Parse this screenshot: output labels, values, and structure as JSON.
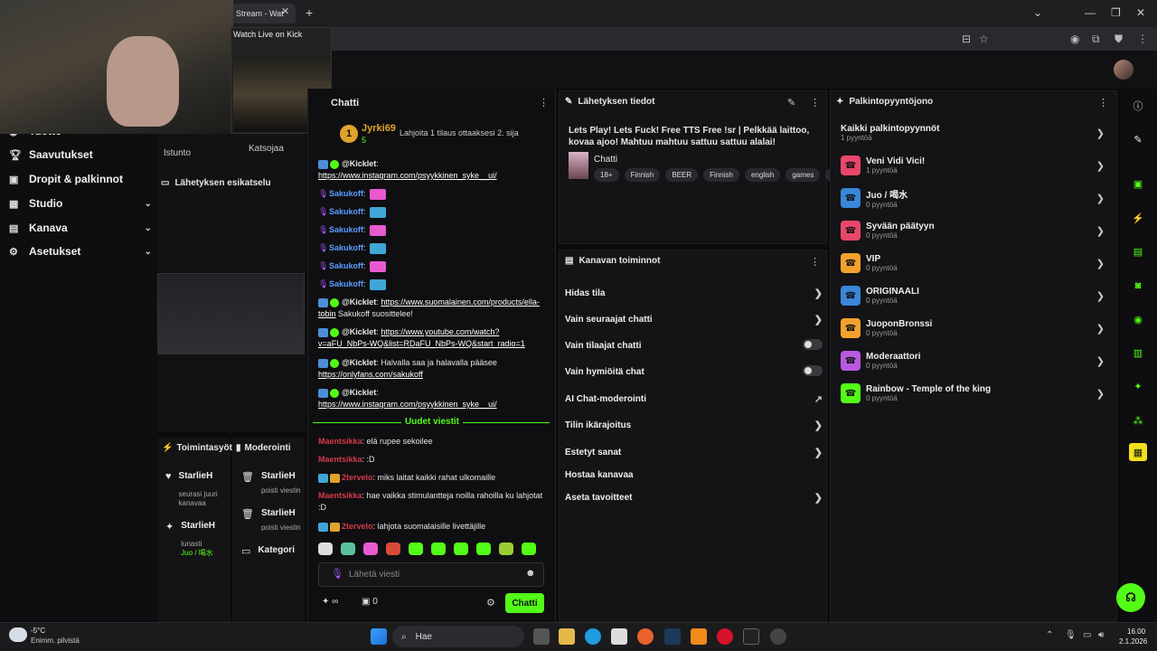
{
  "browser": {
    "tab_title": "Stream - Wat",
    "tab_close": "✕",
    "new_tab": "+",
    "pip_title": "Watch Live on Kick"
  },
  "nav": {
    "items": [
      {
        "label": "Tuotto",
        "icon": "coin-icon"
      },
      {
        "label": "Saavutukset",
        "icon": "trophy-icon"
      },
      {
        "label": "Dropit & palkinnot",
        "icon": "gift-icon"
      },
      {
        "label": "Studio",
        "icon": "studio-icon",
        "chevron": "⌄"
      },
      {
        "label": "Kanava",
        "icon": "channel-icon",
        "chevron": "⌄"
      },
      {
        "label": "Asetukset",
        "icon": "gear-icon",
        "chevron": "⌄"
      }
    ]
  },
  "preview": {
    "tab_istunto": "Istunto",
    "tab_katsojaa": "Katsojaa",
    "title": "Lähetyksen esikatselu"
  },
  "activity": {
    "title": "Toimintasyöte",
    "items": [
      {
        "name": "StarlieH",
        "sub": "seurasi juuri kanavaa"
      },
      {
        "name": "StarlieH",
        "sub": "lunasti",
        "sub2": "Juo / 喝水"
      }
    ]
  },
  "moderation": {
    "title": "Moderointi",
    "items": [
      {
        "name": "StarlieH",
        "sub": "poisti viestin"
      },
      {
        "name": "StarlieH",
        "sub": "poisti viestin"
      },
      {
        "name": "Kategori",
        "sub": ""
      }
    ]
  },
  "chat": {
    "title": "Chatti",
    "gifter": {
      "badge": "1",
      "name": "Jyrki69",
      "count": "5",
      "note": "Lahjoita 1 tilaus ottaaksesi 2. sija"
    },
    "messages": [
      {
        "user": "@Kicklet",
        "text": "https://www.instagram.com/psyykkinen_syke__ui/",
        "type": "bot"
      },
      {
        "user": "Sakukoff",
        "text": "",
        "type": "emote",
        "emote_color": "#e85ad0"
      },
      {
        "user": "Sakukoff",
        "text": "",
        "type": "emote",
        "emote_color": "#3fa7d6"
      },
      {
        "user": "Sakukoff",
        "text": "",
        "type": "emote",
        "emote_color": "#e85ad0"
      },
      {
        "user": "Sakukoff",
        "text": "",
        "type": "emote",
        "emote_color": "#3fa7d6"
      },
      {
        "user": "Sakukoff",
        "text": "",
        "type": "emote",
        "emote_color": "#e85ad0"
      },
      {
        "user": "Sakukoff",
        "text": "",
        "type": "emote",
        "emote_color": "#3fa7d6"
      },
      {
        "user": "@Kicklet",
        "link": "https://www.suomalainen.com/products/ella-tobin",
        "text": "Sakukoff suosittelee!",
        "type": "bot"
      },
      {
        "user": "@Kicklet",
        "link": "https://www.youtube.com/watch?v=aFU_NbPs-WQ&list=RDaFU_NbPs-WQ&start_radio=1",
        "text": "",
        "type": "bot"
      },
      {
        "user": "@Kicklet",
        "text": "Halvalla saa ja halavalla pääsee",
        "link": "https://onlyfans.com/sakukoff",
        "type": "bot"
      },
      {
        "user": "@Kicklet",
        "link": "https://www.instagram.com/psyykkinen_syke__ui/",
        "text": "",
        "type": "bot"
      }
    ],
    "new_messages_label": "Uudet viestit",
    "new_messages": [
      {
        "user": "Maentsikka",
        "text": "elä rupee sekoilee"
      },
      {
        "user": "Maentsikka",
        "text": ":D"
      },
      {
        "user": "2tervelo",
        "text": "miks laitat kaikki rahat ulkomaille"
      },
      {
        "user": "Maentsikka",
        "text": "hae vaikka stimulantteja noilla rahoilla ku lahjotat :D"
      },
      {
        "user": "2tervelo",
        "text": "lahjota suomalaisille livettäjille"
      }
    ],
    "input_placeholder": "Lähetä viesti",
    "bottom_count": "0",
    "send_label": "Chatti"
  },
  "stream_info": {
    "title": "Lähetyksen tiedot",
    "description": "Lets Play! Lets Fuck! Free TTS Free !sr | Pelkkää laittoo, kovaa ajoo! Mahtuu mahtuu sattuu sattuu alalai!",
    "category": "Chatti",
    "tags": [
      "18+",
      "Finnish",
      "BEER",
      "Finnish",
      "english",
      "games",
      "ja"
    ]
  },
  "channel_actions": {
    "title": "Kanavan toiminnot",
    "items": [
      {
        "label": "Hidas tila",
        "control": "chevron"
      },
      {
        "label": "Vain seuraajat chatti",
        "control": "chevron"
      },
      {
        "label": "Vain tilaajat chatti",
        "control": "toggle"
      },
      {
        "label": "Vain hymiöitä chat",
        "control": "toggle"
      },
      {
        "label": "AI Chat-moderointi",
        "control": "external"
      },
      {
        "label": "Tilin ikärajoitus",
        "control": "chevron"
      },
      {
        "label": "Estetyt sanat",
        "control": "chevron"
      },
      {
        "label": "Hostaa kanavaa",
        "control": "none"
      },
      {
        "label": "Aseta tavoitteet",
        "control": "chevron"
      }
    ]
  },
  "rewards": {
    "title": "Palkintopyyntöjono",
    "all": {
      "name": "Kaikki palkintopyynnöt",
      "sub": "1 pyyntöä"
    },
    "items": [
      {
        "name": "Veni Vidi Vici!",
        "sub": "1 pyyntöä",
        "color": "#e8476a"
      },
      {
        "name": "Juo / 喝水",
        "sub": "0 pyyntöä",
        "color": "#3a86d8"
      },
      {
        "name": "Syvään päätyyn",
        "sub": "0 pyyntöä",
        "color": "#e8476a"
      },
      {
        "name": "VIP",
        "sub": "0 pyyntöä",
        "color": "#f2a22c"
      },
      {
        "name": "ORIGINAALI",
        "sub": "0 pyyntöä",
        "color": "#3a86d8"
      },
      {
        "name": "JuoponBronssi",
        "sub": "0 pyyntöä",
        "color": "#f2a22c"
      },
      {
        "name": "Moderaattori",
        "sub": "0 pyyntöä",
        "color": "#b65ae0"
      },
      {
        "name": "Rainbow - Temple of the king",
        "sub": "0 pyyntöä",
        "color": "#53fc18"
      }
    ]
  },
  "taskbar": {
    "weather_temp": "-5°C",
    "weather_desc": "Enimm. pilvistä",
    "search_placeholder": "Hae",
    "time": "16.00",
    "date": "2.1.2026"
  },
  "colors": {
    "accent": "#53fc18",
    "bg": "#0b0b0d"
  }
}
